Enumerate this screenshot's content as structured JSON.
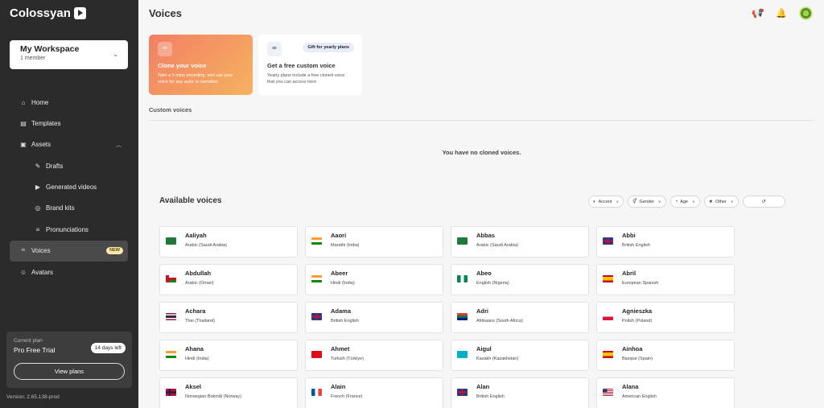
{
  "app": {
    "name": "Colossyan"
  },
  "workspace": {
    "name": "My Workspace",
    "members": "1 member"
  },
  "nav": {
    "home": "Home",
    "templates": "Templates",
    "assets": "Assets",
    "drafts": "Drafts",
    "generated_videos": "Generated videos",
    "brand_kits": "Brand kits",
    "pronunciations": "Pronunciations",
    "voices": "Voices",
    "voices_badge": "NEW",
    "avatars": "Avatars"
  },
  "plan": {
    "label": "Current plan",
    "name": "Pro Free Trial",
    "days_left": "14 days left",
    "button": "View plans"
  },
  "version": "Version: 2.65.138-prod",
  "page": {
    "title": "Voices"
  },
  "promo": {
    "clone_title": "Clone your voice",
    "clone_desc": "Take a 5 mins recording, and use your voice for any actor or narration",
    "gift_badge": "Gift for yearly plans",
    "gift_title": "Get a free custom voice",
    "gift_desc": "Yearly plans include a free cloned voice that you can access here"
  },
  "custom_voices": {
    "label": "Custom voices",
    "empty": "You have no cloned voices."
  },
  "available": {
    "title": "Available voices",
    "filters": {
      "accent": "Accent",
      "gender": "Gender",
      "age": "Age",
      "other": "Other"
    }
  },
  "voices": [
    {
      "name": "Aaliyah",
      "lang": "Arabic (Saudi Arabia)",
      "flag": "sa"
    },
    {
      "name": "Aaori",
      "lang": "Marathi (India)",
      "flag": "in"
    },
    {
      "name": "Abbas",
      "lang": "Arabic (Saudi Arabia)",
      "flag": "sa"
    },
    {
      "name": "Abbi",
      "lang": "British English",
      "flag": "gb"
    },
    {
      "name": "Abdullah",
      "lang": "Arabic (Oman)",
      "flag": "om"
    },
    {
      "name": "Abeer",
      "lang": "Hindi (India)",
      "flag": "in"
    },
    {
      "name": "Abeo",
      "lang": "English (Nigeria)",
      "flag": "ng"
    },
    {
      "name": "Abril",
      "lang": "European Spanish",
      "flag": "es"
    },
    {
      "name": "Achara",
      "lang": "Thai (Thailand)",
      "flag": "th"
    },
    {
      "name": "Adama",
      "lang": "British English",
      "flag": "gb"
    },
    {
      "name": "Adri",
      "lang": "Afrikaans (South Africa)",
      "flag": "za"
    },
    {
      "name": "Agnieszka",
      "lang": "Polish (Poland)",
      "flag": "pl"
    },
    {
      "name": "Ahana",
      "lang": "Hindi (India)",
      "flag": "in"
    },
    {
      "name": "Ahmet",
      "lang": "Turkish (Türkiye)",
      "flag": "tr"
    },
    {
      "name": "Aigul",
      "lang": "Kazakh (Kazakhstan)",
      "flag": "kz"
    },
    {
      "name": "Ainhoa",
      "lang": "Basque (Spain)",
      "flag": "es"
    },
    {
      "name": "Aksel",
      "lang": "Norwegian Bokmål (Norway)",
      "flag": "no"
    },
    {
      "name": "Alain",
      "lang": "French (France)",
      "flag": "fr"
    },
    {
      "name": "Alan",
      "lang": "British English",
      "flag": "gb"
    },
    {
      "name": "Alana",
      "lang": "American English",
      "flag": "us"
    }
  ]
}
